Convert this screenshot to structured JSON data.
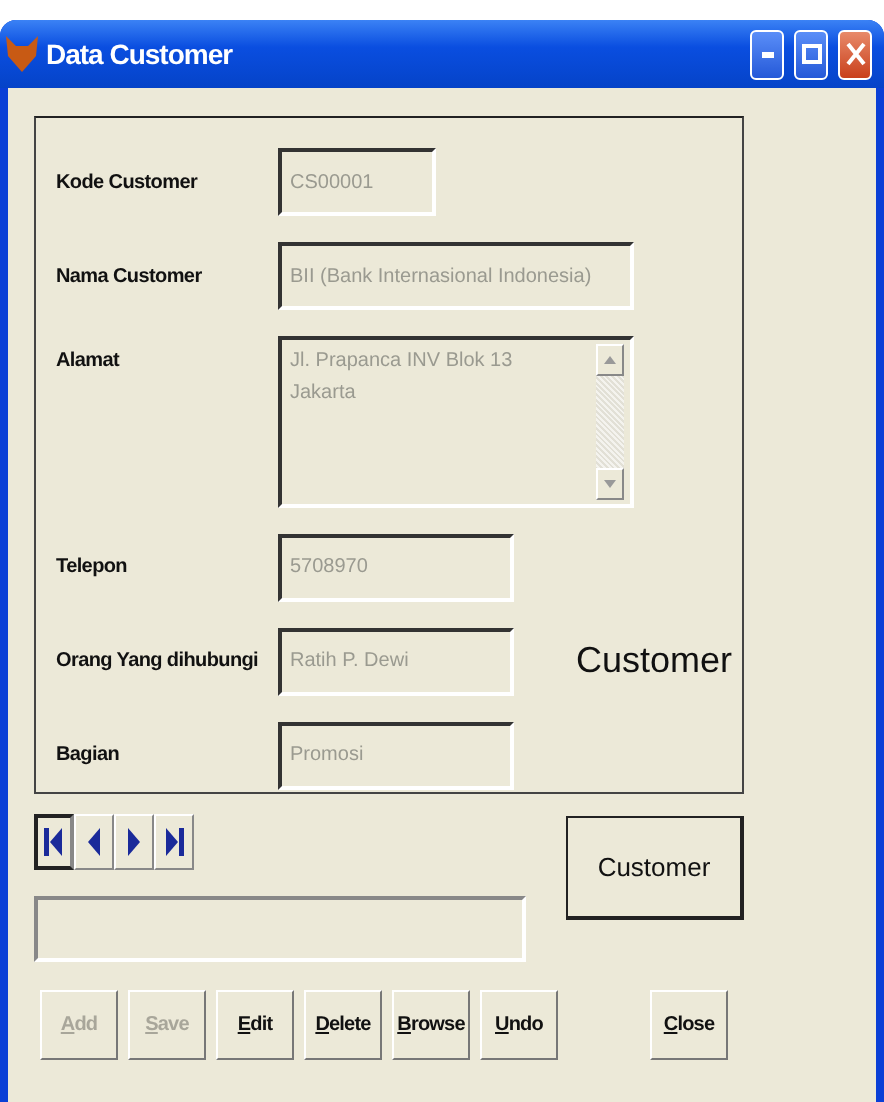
{
  "window": {
    "title": "Data Customer"
  },
  "fields": [
    {
      "label": "Kode Customer",
      "value": "CS00001",
      "kind": "short"
    },
    {
      "label": "Nama Customer",
      "value": "BII (Bank Internasional Indonesia)",
      "kind": "long"
    },
    {
      "label": "Alamat",
      "value": "Jl. Prapanca INV Blok 13\nJakarta",
      "kind": "memo"
    },
    {
      "label": "Telepon",
      "value": "5708970",
      "kind": "medium"
    },
    {
      "label": "Orang Yang dihubungi",
      "value": "Ratih P. Dewi",
      "kind": "medium"
    },
    {
      "label": "Bagian",
      "value": "Promosi",
      "kind": "medium"
    }
  ],
  "caption": "Customer",
  "navigator": [
    {
      "kind": "first",
      "focused": true
    },
    {
      "kind": "prev",
      "focused": false
    },
    {
      "kind": "next",
      "focused": false
    },
    {
      "kind": "last",
      "focused": false
    }
  ],
  "customer_button": "Customer",
  "buttons": [
    {
      "label": "Add",
      "disabled": true
    },
    {
      "label": "Save",
      "disabled": true
    },
    {
      "label": "Edit",
      "disabled": false
    },
    {
      "label": "Delete",
      "disabled": false
    },
    {
      "label": "Browse",
      "disabled": false
    },
    {
      "label": "Undo",
      "disabled": false
    },
    {
      "label": "Close",
      "disabled": false
    }
  ]
}
